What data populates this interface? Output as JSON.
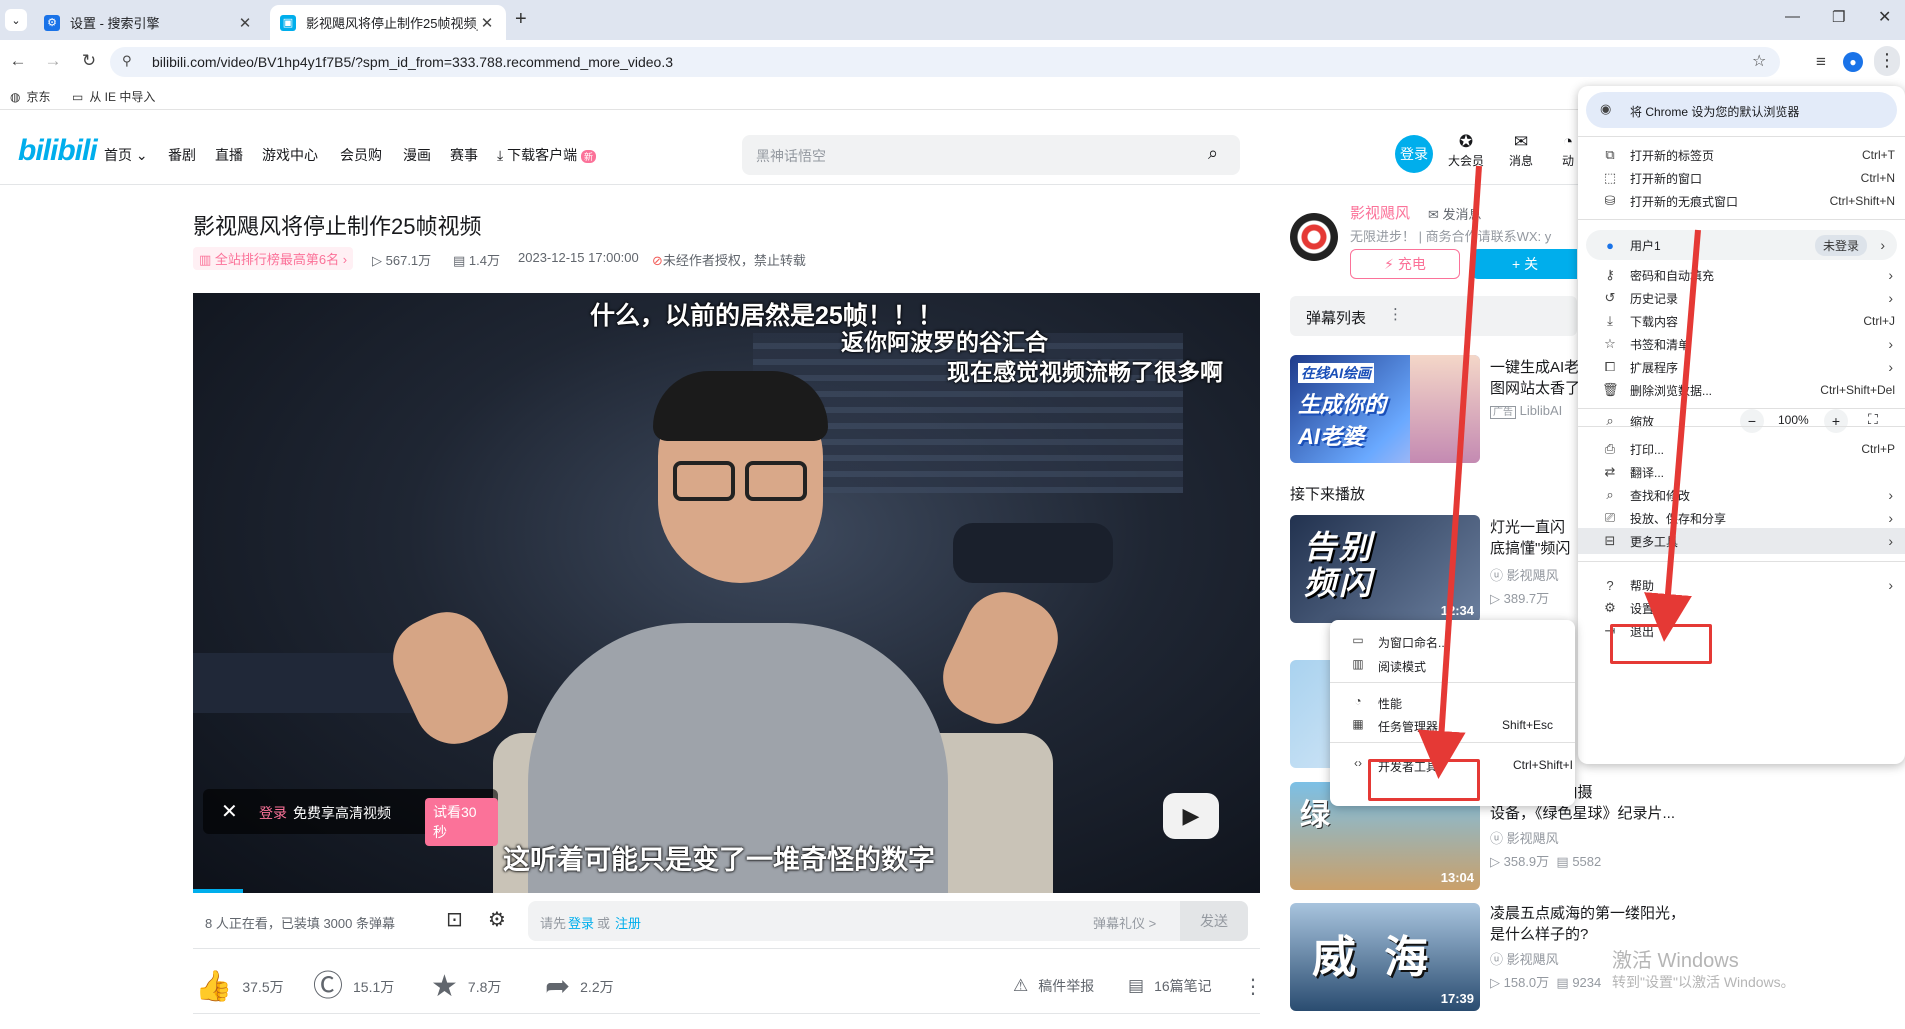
{
  "browser": {
    "tabs": [
      {
        "title": "设置 - 搜索引擎",
        "active": false
      },
      {
        "title": "影视飓风将停止制作25帧视频_哔",
        "active": true
      }
    ],
    "new_tab": "+",
    "url": "bilibili.com/video/BV1hp4y1f7B5/?spm_id_from=333.788.recommend_more_video.3",
    "bookmarks": [
      "京东",
      "从 IE 中导入"
    ]
  },
  "header": {
    "logo": "bilibili",
    "nav": [
      "首页",
      "番剧",
      "直播",
      "游戏中心",
      "会员购",
      "漫画",
      "赛事",
      "下载客户端"
    ],
    "new_badge": "新",
    "search_placeholder": "黑神话悟空",
    "login": "登录",
    "icons": [
      "大会员",
      "消息",
      "动"
    ]
  },
  "video": {
    "title": "影视飓风将停止制作25帧视频",
    "rank": "全站排行榜最高第6名",
    "views": "567.1万",
    "danmaku_count": "1.4万",
    "date": "2023-12-15 17:00:00",
    "copyright": "未经作者授权，禁止转载",
    "subtitles": [
      "什么，以前的居然是25帧！！！",
      "返你阿波罗的谷汇合",
      "现在感觉视频流畅了很多啊",
      "这听着可能只是变了一堆奇怪的数字"
    ],
    "login_tip_1": "登录",
    "login_tip_2": "免费享高清视频",
    "trial": "试看30秒",
    "watching": "8 人正在看，已装填 3000 条弹幕",
    "dm_placeholder_1": "请先",
    "dm_login": "登录",
    "dm_or": "或",
    "dm_register": "注册",
    "dm_etiquette": "弹幕礼仪 >",
    "send": "发送",
    "actions": {
      "like": "37.5万",
      "coin": "15.1万",
      "fav": "7.8万",
      "share": "2.2万"
    },
    "report": "稿件举报",
    "notes": "16篇笔记"
  },
  "uploader": {
    "name": "影视飓风",
    "msg": "发消息",
    "desc": "无限进步！ | 商务合作请联系WX: y",
    "charge": "充电",
    "follow": "+ 关"
  },
  "sidebar": {
    "danmaku_list": "弹幕列表",
    "up_next": "接下来播放",
    "ad": {
      "title_1": "一键生成AI老",
      "title_2": "图网站太香了",
      "tag": "广告",
      "source": "LiblibAI",
      "thumb_text_1": "在线AI绘画",
      "thumb_text_2": "生成你的",
      "thumb_text_3": "AI老婆"
    },
    "recs": [
      {
        "title_1": "灯光一直闪",
        "title_2": "底搞懂\"频闪",
        "author": "影视飓风",
        "views": "389.7万",
        "dur": "12:34",
        "thumb_text": "告别频闪"
      },
      {
        "title_1": "",
        "title_2": "",
        "author": "",
        "views": "",
        "dur": "",
        "thumb_text": ""
      },
      {
        "title_1": "镜头? 自造拍摄",
        "title_2": "设备，《绿色星球》纪录片...",
        "author": "影视飓风",
        "views": "358.9万",
        "dm": "5582",
        "dur": "13:04",
        "thumb_text": "绿"
      },
      {
        "title_1": "凌晨五点威海的第一缕阳光，",
        "title_2": "是什么样子的?",
        "author": "影视飓风",
        "views": "158.0万",
        "dm": "9234",
        "dur": "17:39",
        "thumb_text": "威 海"
      }
    ]
  },
  "chrome_menu": {
    "default_banner": "将 Chrome 设为您的默认浏览器",
    "items": [
      {
        "label": "打开新的标签页",
        "shortcut": "Ctrl+T"
      },
      {
        "label": "打开新的窗口",
        "shortcut": "Ctrl+N"
      },
      {
        "label": "打开新的无痕式窗口",
        "shortcut": "Ctrl+Shift+N"
      },
      {
        "label": "用户1",
        "shortcut": "未登录"
      },
      {
        "label": "密码和自动填充",
        "shortcut": ""
      },
      {
        "label": "历史记录",
        "shortcut": ""
      },
      {
        "label": "下载内容",
        "shortcut": "Ctrl+J"
      },
      {
        "label": "书签和清单",
        "shortcut": ""
      },
      {
        "label": "扩展程序",
        "shortcut": ""
      },
      {
        "label": "删除浏览数据...",
        "shortcut": "Ctrl+Shift+Del"
      },
      {
        "label": "缩放",
        "shortcut": ""
      },
      {
        "label": "打印...",
        "shortcut": "Ctrl+P"
      },
      {
        "label": "翻译...",
        "shortcut": ""
      },
      {
        "label": "查找和修改",
        "shortcut": ""
      },
      {
        "label": "投放、保存和分享",
        "shortcut": ""
      },
      {
        "label": "更多工具",
        "shortcut": ""
      },
      {
        "label": "帮助",
        "shortcut": ""
      },
      {
        "label": "设置",
        "shortcut": ""
      },
      {
        "label": "退出",
        "shortcut": ""
      }
    ],
    "zoom": "100%",
    "zoom_minus": "−",
    "zoom_plus": "+"
  },
  "more_tools_menu": {
    "items": [
      {
        "label": "为窗口命名...",
        "shortcut": ""
      },
      {
        "label": "阅读模式",
        "shortcut": ""
      },
      {
        "label": "性能",
        "shortcut": ""
      },
      {
        "label": "任务管理器",
        "shortcut": "Shift+Esc"
      },
      {
        "label": "开发者工具",
        "shortcut": "Ctrl+Shift+I"
      }
    ]
  },
  "watermark": {
    "line1": "激活 Windows",
    "line2": "转到\"设置\"以激活 Windows。"
  },
  "colors": {
    "bili_blue": "#00aeec",
    "bili_pink": "#fb7299",
    "annotation_red": "#e53935"
  }
}
